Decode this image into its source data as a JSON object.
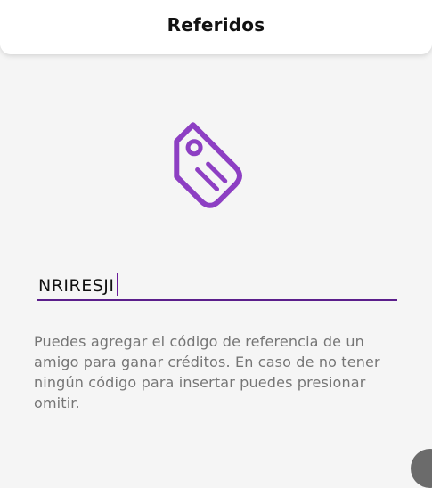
{
  "header": {
    "title": "Referidos"
  },
  "icon": {
    "name": "tag-icon",
    "color": "#8d3fc3"
  },
  "referral_field": {
    "value": "NRIRESJI",
    "underline_color": "#5b1e8b"
  },
  "help_text": "Puedes agregar el código de referencia de un amigo para ganar créditos. En caso de no tener ningún código para insertar puedes presionar omitir."
}
